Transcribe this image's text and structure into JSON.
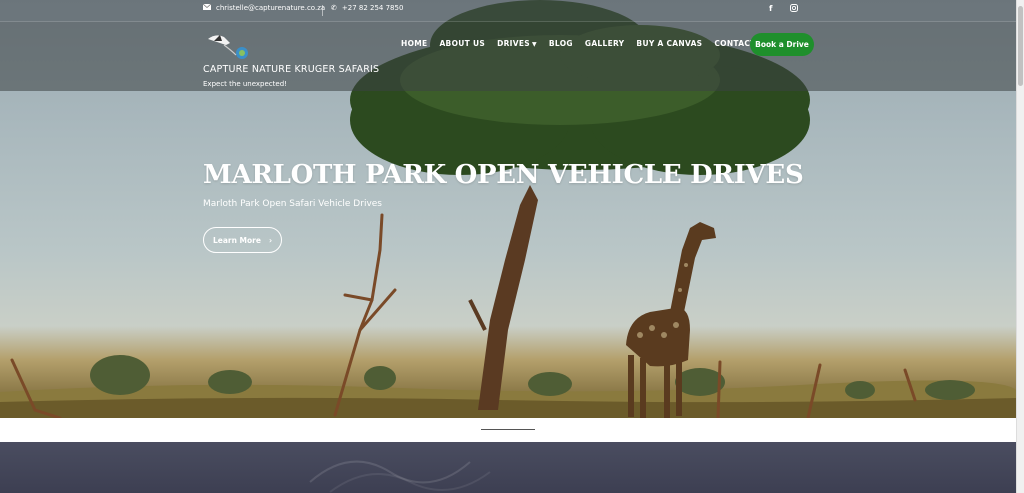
{
  "topbar": {
    "email": "christelle@capturenature.co.za",
    "phone": "+27 82 254 7850",
    "icons": {
      "email": "envelope-icon",
      "phone": "phone-icon",
      "facebook": "facebook-icon",
      "instagram": "instagram-icon"
    }
  },
  "brand": {
    "title": "CAPTURE NATURE KRUGER SAFARIS",
    "tagline": "Expect the unexpected!"
  },
  "nav": {
    "items": [
      "HOME",
      "ABOUT US",
      "DRIVES",
      "BLOG",
      "GALLERY",
      "BUY A CANVAS",
      "CONTACT US"
    ],
    "book_label": "Book a Drive",
    "book_color": "#1f8f2c"
  },
  "hero": {
    "title": "MARLOTH PARK OPEN VEHICLE DRIVES",
    "subtitle": "Marloth Park Open Safari Vehicle Drives",
    "cta": "Learn More"
  }
}
